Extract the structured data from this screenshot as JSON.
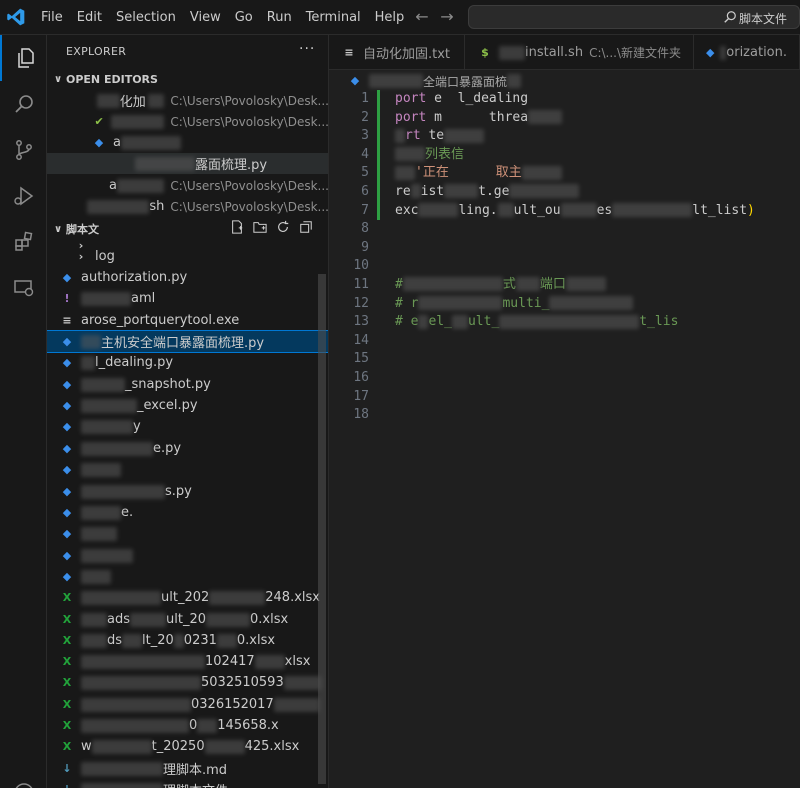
{
  "menu": [
    "File",
    "Edit",
    "Selection",
    "View",
    "Go",
    "Run",
    "Terminal",
    "Help"
  ],
  "search": {
    "text": "脚本文件"
  },
  "explorer": {
    "title": "EXPLORER",
    "more": "···",
    "open_editors_label": "OPEN EDITORS",
    "open_editors": [
      {
        "name": "自动化加固.txt",
        "shown": "化加",
        "path": "C:\\Users\\Povolosky\\Desk..."
      },
      {
        "name": "install.sh",
        "shown": "",
        "path": "C:\\Users\\Povolosky\\Desk..."
      },
      {
        "name": "authorization.py",
        "shown": "a",
        "path": ""
      },
      {
        "name": "主机安全端口暴露面梳理.py",
        "shown": "露面梳理.py",
        "path": ""
      },
      {
        "name": "",
        "shown": "a",
        "path": "C:\\Users\\Povolosky\\Desk..."
      },
      {
        "name": "",
        "shown": "sh",
        "path": "C:\\Users\\Povolosky\\Desk..."
      }
    ],
    "folder_label": "脚本文",
    "files": [
      {
        "label": "",
        "type": "folder"
      },
      {
        "label": "log",
        "type": "folder"
      },
      {
        "label": "authorization.py",
        "type": "py"
      },
      {
        "label": "aml",
        "type": "yml"
      },
      {
        "label": "arose_portquerytool.exe",
        "type": "exe"
      },
      {
        "label": "主机安全端口暴露面梳理.py",
        "type": "py"
      },
      {
        "label": "l_dealing.py",
        "type": "py"
      },
      {
        "label": "_snapshot.py",
        "type": "py"
      },
      {
        "label": "_excel.py",
        "type": "py"
      },
      {
        "label": "y",
        "type": "py"
      },
      {
        "label": "e.py",
        "type": "py"
      },
      {
        "label": "",
        "type": "py"
      },
      {
        "label": "s.py",
        "type": "py"
      },
      {
        "label": "e.",
        "type": "py"
      },
      {
        "label": "",
        "type": "py"
      },
      {
        "label": "",
        "type": "py"
      },
      {
        "label": "",
        "type": "py"
      },
      {
        "label": "ult_202",
        "label2": "248.xlsx",
        "type": "xls"
      },
      {
        "label": "ads",
        "label2": "ult_20",
        "label3": "0.xlsx",
        "type": "xls"
      },
      {
        "label": "ds",
        "label2": "lt_20",
        "label3": "0231",
        "label4": "0.xlsx",
        "type": "xls"
      },
      {
        "label": "102417",
        "label2": "xlsx",
        "type": "xls"
      },
      {
        "label": "5032510593",
        "type": "xls"
      },
      {
        "label": "0326152017",
        "type": "xls"
      },
      {
        "label": "0",
        "label2": "145658.x",
        "type": "xls"
      },
      {
        "label": "w",
        "label2": "t_20250",
        "label3": "425.xlsx",
        "type": "xls"
      },
      {
        "label": "理脚本.md",
        "type": "md"
      },
      {
        "label": "理脚本文件",
        "type": "md"
      }
    ]
  },
  "tabs": [
    {
      "label": "自动化加固.txt",
      "icon": "txt"
    },
    {
      "label": "install.sh",
      "path": "C:\\...\\新建文件夹",
      "icon": "sh"
    },
    {
      "label": "orization.",
      "icon": "py"
    }
  ],
  "breadcrumb": "全端口暴露面梳",
  "line_numbers": [
    "1",
    "2",
    "3",
    "4",
    "5",
    "6",
    "7",
    "8",
    "9",
    "10",
    "11",
    "12",
    "13",
    "14",
    "15",
    "16",
    "17",
    "18"
  ],
  "code": {
    "l1_kw": "port",
    "l1_rest": " e  l_dealing",
    "l2_kw": "port",
    "l2_rest": " m      threa",
    "l3_kw": "rt",
    "l3_rest": " te",
    "l4": "列表信",
    "l5": "'正在      取主",
    "l6_a": "re",
    "l6_b": "ist",
    "l6_c": "t.ge",
    "l7_a": "exc",
    "l7_b": "ling.",
    "l7_c": "ult_ou",
    "l7_d": "es",
    "l7_e": "lt_list",
    "l7_paren": ")",
    "l11": "#",
    "l11_b": "式",
    "l11_c": "端口",
    "l12": "# r",
    "l12_b": "multi_",
    "l13": "# e",
    "l13_b": "el_",
    "l13_c": "ult_",
    "l13_d": "t_lis"
  }
}
